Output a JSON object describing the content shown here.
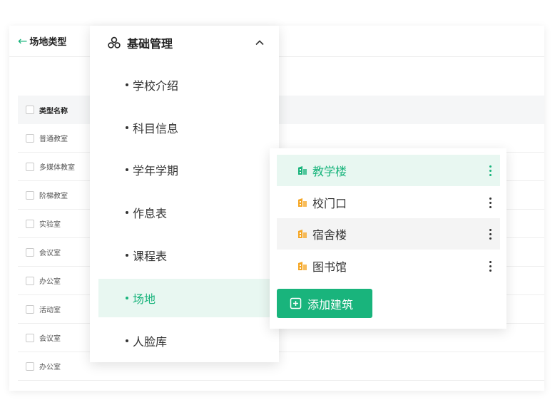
{
  "background": {
    "back_arrow": "←",
    "title": "场地类型",
    "table": {
      "header": "类型名称",
      "rows": [
        "普通教室",
        "多媒体教室",
        "阶梯教室",
        "实验室",
        "会议室",
        "办公室",
        "活动室",
        "会议室",
        "办公室"
      ]
    }
  },
  "menu": {
    "header_icon": "three-circles-icon",
    "title": "基础管理",
    "collapse_icon": "chevron-up-icon",
    "items": [
      "学校介绍",
      "科目信息",
      "学年学期",
      "作息表",
      "课程表",
      "场地",
      "人脸库"
    ],
    "active_index": 5
  },
  "buildings": {
    "item_icon": "building-icon",
    "more_icon": "more-vertical-icon",
    "items": [
      "教学楼",
      "校门口",
      "宿舍楼",
      "图书馆"
    ],
    "selected_index": 0,
    "add_label": "添加建筑",
    "add_icon": "plus-square-icon"
  },
  "colors": {
    "accent": "#19b47c",
    "accent_light": "#e8f7f1",
    "building_icon": "#f5a623"
  }
}
